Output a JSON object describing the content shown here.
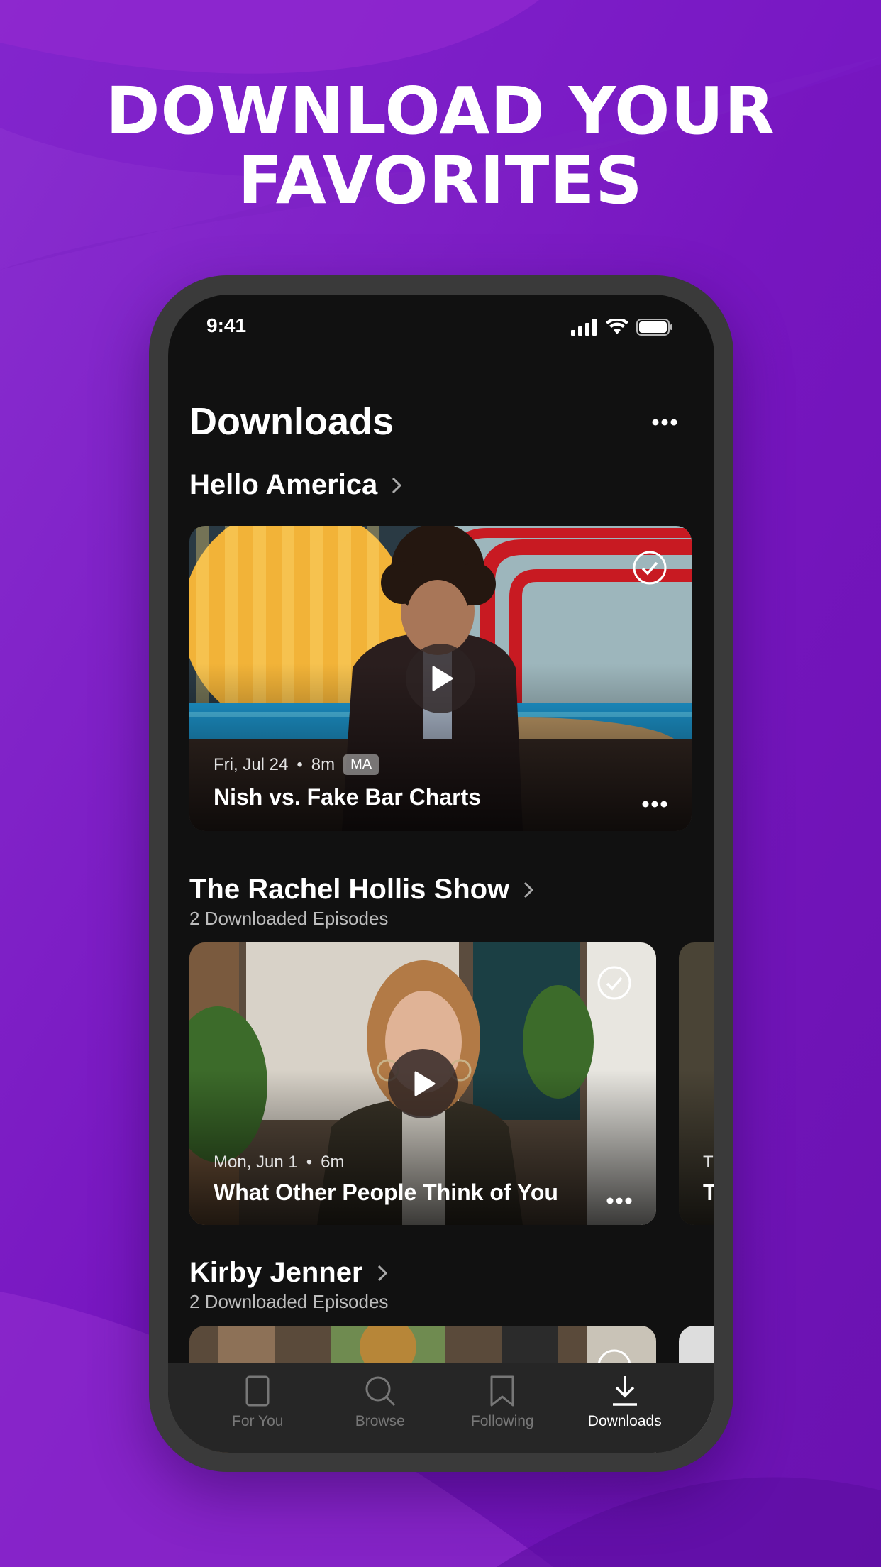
{
  "headline": {
    "line1": "DOWNLOAD YOUR",
    "line2": "FAVORITES"
  },
  "status_bar": {
    "time": "9:41"
  },
  "page": {
    "title": "Downloads",
    "more_icon": "more-dots-icon"
  },
  "sections": [
    {
      "title": "Hello America",
      "subtitle": "",
      "cards": [
        {
          "date": "Fri, Jul 24",
          "duration": "8m",
          "rating": "MA",
          "title": "Nish vs. Fake Bar Charts",
          "downloaded": true
        }
      ]
    },
    {
      "title": "The Rachel Hollis Show",
      "subtitle": "2 Downloaded Episodes",
      "cards": [
        {
          "date": "Mon, Jun 1",
          "duration": "6m",
          "title": "What Other People Think of You",
          "downloaded": true
        },
        {
          "date_partial": "Tu",
          "title_partial": "T"
        }
      ]
    },
    {
      "title": "Kirby Jenner",
      "subtitle": "2 Downloaded Episodes",
      "cards": []
    }
  ],
  "tabbar": {
    "items": [
      {
        "label": "For You",
        "icon": "square-icon",
        "active": false
      },
      {
        "label": "Browse",
        "icon": "search-icon",
        "active": false
      },
      {
        "label": "Following",
        "icon": "bookmark-icon",
        "active": false
      },
      {
        "label": "Downloads",
        "icon": "download-icon",
        "active": true
      }
    ]
  },
  "colors": {
    "background_purple": "#7a1fc4",
    "phone_bezel": "#3a3a3a",
    "screen_bg": "#111111",
    "tabbar_bg": "#262626"
  }
}
